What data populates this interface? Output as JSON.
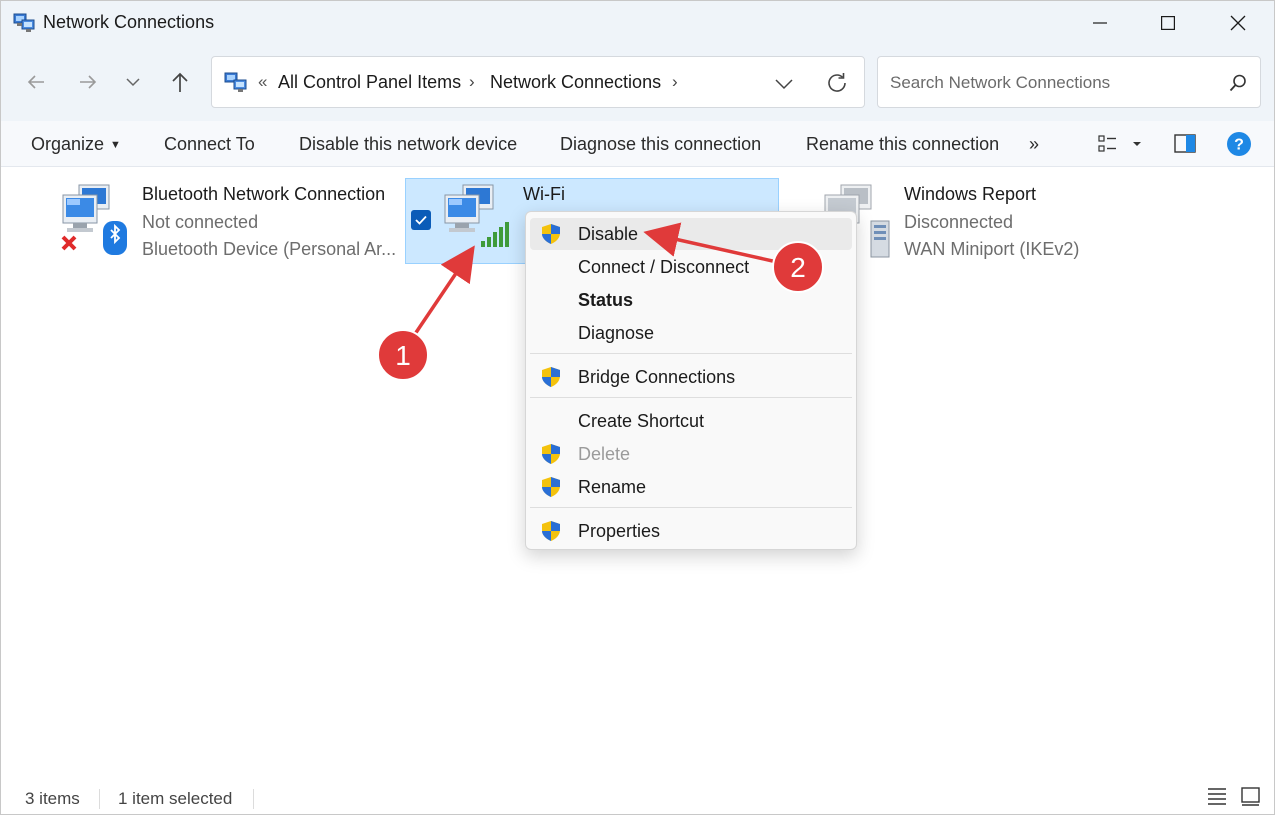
{
  "window": {
    "title": "Network Connections"
  },
  "nav": {
    "breadcrumb_overflow": "«",
    "breadcrumbs": [
      "All Control Panel Items",
      "Network Connections"
    ],
    "crumb_sep": "›",
    "search_placeholder": "Search Network Connections"
  },
  "toolbar": {
    "organize": "Organize",
    "connect_to": "Connect To",
    "disable_device": "Disable this network device",
    "diagnose": "Diagnose this connection",
    "rename": "Rename this connection",
    "more": "»"
  },
  "connections": [
    {
      "name": "Bluetooth Network Connection",
      "status": "Not connected",
      "device": "Bluetooth Device (Personal Ar..."
    },
    {
      "name": "Wi-Fi",
      "selected": true
    },
    {
      "name": "Windows Report",
      "status": "Disconnected",
      "device": "WAN Miniport (IKEv2)"
    }
  ],
  "context_menu": {
    "items": [
      {
        "label": "Disable",
        "shield": true
      },
      {
        "label": "Connect / Disconnect",
        "shield": false
      },
      {
        "label": "Status",
        "shield": false,
        "bold": true
      },
      {
        "label": "Diagnose",
        "shield": false
      },
      {
        "label": "Bridge Connections",
        "shield": true
      },
      {
        "label": "Create Shortcut",
        "shield": false
      },
      {
        "label": "Delete",
        "shield": true,
        "disabled": true
      },
      {
        "label": "Rename",
        "shield": true
      },
      {
        "label": "Properties",
        "shield": true
      }
    ]
  },
  "annotations": {
    "step1": "1",
    "step2": "2",
    "color": "#e03a3a"
  },
  "status": {
    "items_count": "3 items",
    "selected_count": "1 item selected"
  },
  "colors": {
    "selection_bg": "#cce8ff",
    "accent": "#0b5cb8",
    "help": "#1e88e5"
  }
}
